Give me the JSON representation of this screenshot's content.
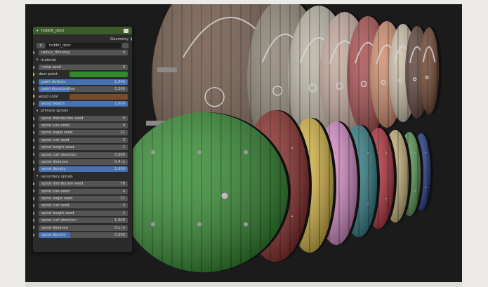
{
  "node": {
    "title": "hobbit_door",
    "output_label": "Geometry",
    "object_name": "hobbit_door",
    "radius_thinning": {
      "label": "radius_thinning",
      "value": "0"
    },
    "sections": {
      "material": "material",
      "primary": "primary spirals",
      "secondary": "secondary spirals"
    },
    "material": {
      "noise_seed": {
        "label": "noise seed",
        "value": "0"
      },
      "door_paint": {
        "label": "door paint",
        "color": "#2f8a2c"
      },
      "paint_defects": {
        "label": "paint defects",
        "value": "1.000"
      },
      "paint_discoloration": {
        "label": "paint discoloration",
        "value": "0.300"
      },
      "wood_color": {
        "label": "wood color",
        "color": "#7a4b2a"
      },
      "wood_bleach": {
        "label": "wood bleach",
        "value": "1.000"
      }
    },
    "primary": [
      {
        "label": "spiral distribution seed",
        "value": "0"
      },
      {
        "label": "spiral size seed",
        "value": "4"
      },
      {
        "label": "spiral angle seed",
        "value": "21"
      },
      {
        "label": "spiral curl seed",
        "value": "3"
      },
      {
        "label": "spiral length seed",
        "value": "1"
      },
      {
        "label": "spiral curl direction",
        "value": "0.500"
      },
      {
        "label": "spiral distance",
        "value": "0.4 m"
      },
      {
        "label": "spiral density",
        "value": "1.000"
      }
    ],
    "secondary": [
      {
        "label": "spiral distribution seed",
        "value": "78"
      },
      {
        "label": "spiral size seed",
        "value": "4"
      },
      {
        "label": "spiral angle seed",
        "value": "21"
      },
      {
        "label": "spiral curl seed",
        "value": "3"
      },
      {
        "label": "spiral length seed",
        "value": "1"
      },
      {
        "label": "spiral curl direction",
        "value": "1.000"
      },
      {
        "label": "spiral distance",
        "value": "0.1 m"
      },
      {
        "label": "spiral density",
        "value": "0.500"
      }
    ]
  },
  "colors": {
    "front_doors": [
      "#2f8a2c",
      "#8a2a26",
      "#d8b743",
      "#d68ac7",
      "#2f7f86",
      "#b62f3b",
      "#c9b67a",
      "#5a9a57",
      "#233a8a"
    ],
    "back_doors": [
      "#6b3f2a",
      "#5a4036",
      "#cdbfa8",
      "#cf8a6a",
      "#a84a4a",
      "#c4a89a",
      "#b9b3a3",
      "#8a8070",
      "#6a5140"
    ]
  }
}
